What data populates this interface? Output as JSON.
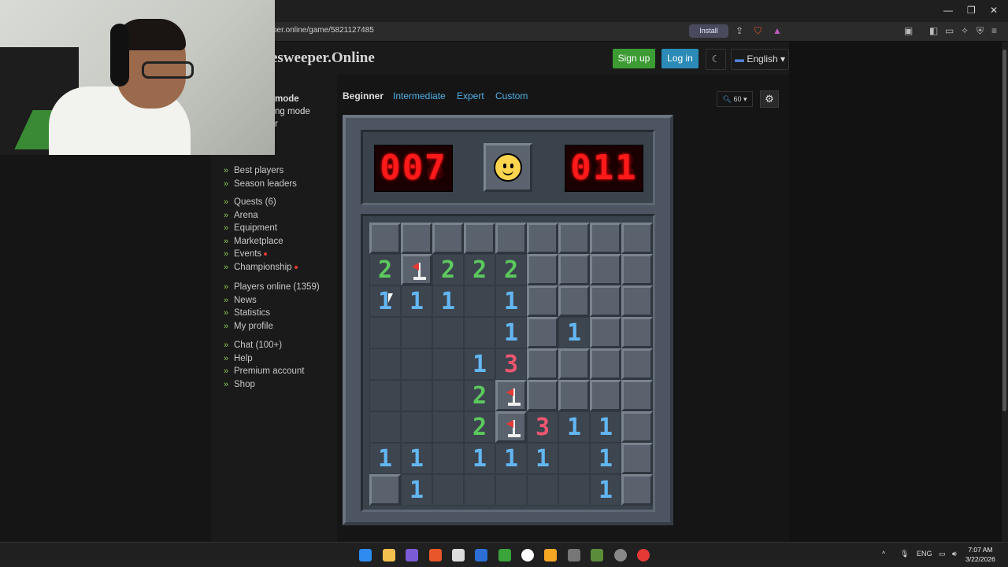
{
  "browser": {
    "url": "per.online/game/5821127485",
    "install_label": "Install",
    "window_controls": [
      "—",
      "❐",
      "✕"
    ]
  },
  "site": {
    "title": "esweeper.Online",
    "signup_label": "Sign up",
    "login_label": "Log in",
    "language_label": "English",
    "theme_icon": "moon-icon"
  },
  "sidebar": {
    "mode_fragments": [
      "mode",
      "ng mode",
      "r"
    ],
    "group1": [
      "Best players",
      "Season leaders"
    ],
    "group2": [
      "Quests (6)",
      "Arena",
      "Equipment",
      "Marketplace",
      "Events",
      "Championship"
    ],
    "group3": [
      "Players online (1359)",
      "News",
      "Statistics",
      "My profile"
    ],
    "group4": [
      "Chat (100+)",
      "Help",
      "Premium account",
      "Shop"
    ]
  },
  "game": {
    "tabs": [
      "Beginner",
      "Intermediate",
      "Expert",
      "Custom"
    ],
    "active_tab": "Beginner",
    "zoom_value": "60",
    "mines_counter": "007",
    "timer": "011",
    "face": "smiley-icon",
    "board": [
      [
        "C",
        "C",
        "C",
        "C",
        "C",
        "C",
        "C",
        "C",
        "C"
      ],
      [
        "2",
        "F",
        "2",
        "2",
        "2",
        "C",
        "C",
        "C",
        "C"
      ],
      [
        "1",
        "1",
        "1",
        "0",
        "1",
        "C",
        "C",
        "C",
        "C"
      ],
      [
        "0",
        "0",
        "0",
        "0",
        "1",
        "C",
        "1",
        "C",
        "C"
      ],
      [
        "0",
        "0",
        "0",
        "1",
        "3",
        "C",
        "C",
        "C",
        "C"
      ],
      [
        "0",
        "0",
        "0",
        "2",
        "F",
        "C",
        "C",
        "C",
        "C"
      ],
      [
        "0",
        "0",
        "0",
        "2",
        "F",
        "3",
        "1",
        "1",
        "C"
      ],
      [
        "1",
        "1",
        "0",
        "1",
        "1",
        "1",
        "0",
        "1",
        "C"
      ],
      [
        "C",
        "1",
        "0",
        "0",
        "0",
        "0",
        "0",
        "1",
        "C"
      ]
    ]
  },
  "taskbar": {
    "lang": "ENG",
    "time": "7:07 AM",
    "date": "3/22/2026"
  },
  "colors": {
    "n1": "#63b6f2",
    "n2": "#5cc85e",
    "n3": "#f0566f",
    "signup": "#3c9b33",
    "login": "#2b8bb6"
  }
}
